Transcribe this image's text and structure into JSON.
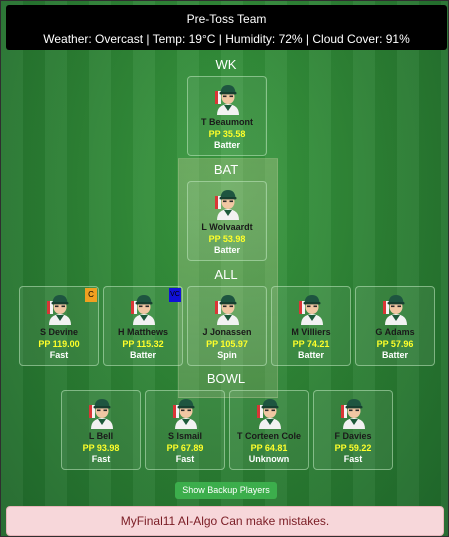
{
  "header": {
    "title": "Pre-Toss Team",
    "weather": "Weather: Overcast | Temp: 19°C | Humidity: 72% | Cloud Cover: 91%"
  },
  "sections": {
    "wk": "WK",
    "bat": "BAT",
    "all": "ALL",
    "bowl": "BOWL"
  },
  "players": {
    "wk": [
      {
        "name": "T Beaumont",
        "pp": "PP 35.58",
        "role": "Batter"
      }
    ],
    "bat": [
      {
        "name": "L Wolvaardt",
        "pp": "PP 53.98",
        "role": "Batter"
      }
    ],
    "all": [
      {
        "name": "S Devine",
        "pp": "PP 119.00",
        "role": "Fast",
        "badge": "C"
      },
      {
        "name": "H Matthews",
        "pp": "PP 115.32",
        "role": "Batter",
        "badge": "VC"
      },
      {
        "name": "J Jonassen",
        "pp": "PP 105.97",
        "role": "Spin"
      },
      {
        "name": "M Villiers",
        "pp": "PP 74.21",
        "role": "Batter"
      },
      {
        "name": "G Adams",
        "pp": "PP 57.96",
        "role": "Batter"
      }
    ],
    "bowl": [
      {
        "name": "L Bell",
        "pp": "PP 93.98",
        "role": "Fast"
      },
      {
        "name": "S Ismail",
        "pp": "PP 67.89",
        "role": "Fast"
      },
      {
        "name": "T Corteen Cole",
        "pp": "PP 64.81",
        "role": "Unknown"
      },
      {
        "name": "F Davies",
        "pp": "PP 59.22",
        "role": "Fast"
      }
    ]
  },
  "icons": {
    "avatar": "player-avatar-icon"
  },
  "colors": {
    "pp_text": "#ffff2a",
    "captain_badge": "#f0a020",
    "vice_captain_badge": "#1010d8",
    "button": "#3cae4c",
    "disclaimer_bg": "#f7d7da"
  },
  "backup_button_label": "Show Backup Players",
  "disclaimer": "MyFinal11 AI-Algo Can make mistakes."
}
